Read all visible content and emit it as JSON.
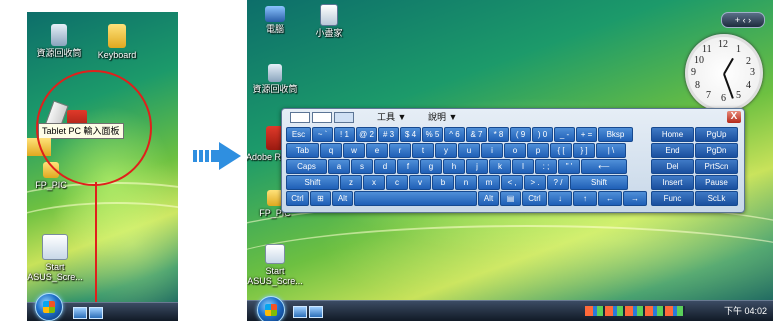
{
  "left_panel": {
    "icons": [
      {
        "name": "recycle-bin",
        "label": "資源回收筒"
      },
      {
        "name": "keyboard-folder",
        "label": "Keyboard"
      },
      {
        "name": "fp-pic",
        "label": "FP_PIC"
      },
      {
        "name": "start-asus",
        "label": "Start ASUS_Scre..."
      }
    ],
    "tooltip": "Tablet PC 輸入面板"
  },
  "right_panel": {
    "icons": [
      {
        "name": "computer",
        "label": "電腦"
      },
      {
        "name": "mini-utility",
        "label": "小盡家"
      },
      {
        "name": "recycle-bin",
        "label": "資源回收筒"
      },
      {
        "name": "adobe-reader",
        "label": "Adobe Reader"
      },
      {
        "name": "fp-pic",
        "label": "FP_PIC"
      },
      {
        "name": "start-asus",
        "label": "Start ASUS_Scre..."
      }
    ],
    "sidebar_controls": "+  ‹  ›",
    "clock_numbers": [
      "12",
      "1",
      "2",
      "3",
      "4",
      "5",
      "6",
      "7",
      "8",
      "9",
      "10",
      "11"
    ],
    "taskbar_time": "下午 04:02"
  },
  "keyboard": {
    "menu_tools": "工具 ▼",
    "menu_help": "說明 ▼",
    "close": "X",
    "rows": [
      [
        "Esc",
        "~ `",
        "! 1",
        "@ 2",
        "# 3",
        "$ 4",
        "% 5",
        "^ 6",
        "& 7",
        "* 8",
        "( 9",
        ") 0",
        "_ -",
        "+ =",
        "Bksp"
      ],
      [
        "Tab",
        "q",
        "w",
        "e",
        "r",
        "t",
        "y",
        "u",
        "i",
        "o",
        "p",
        "{ [",
        "} ]",
        "| \\"
      ],
      [
        "Caps",
        "a",
        "s",
        "d",
        "f",
        "g",
        "h",
        "j",
        "k",
        "l",
        ": ;",
        "\" '",
        "⟵"
      ],
      [
        "Shift",
        "z",
        "x",
        "c",
        "v",
        "b",
        "n",
        "m",
        "< ,",
        "> .",
        "? /",
        "Shift"
      ],
      [
        "Ctrl",
        "⊞",
        "Alt",
        "",
        "Alt",
        "▤",
        "Ctrl",
        "↓",
        "↑",
        "←",
        "→"
      ]
    ],
    "nav": [
      [
        "Home",
        "PgUp"
      ],
      [
        "End",
        "PgDn"
      ],
      [
        "Del",
        "PrtScn"
      ],
      [
        "Insert",
        "Pause"
      ],
      [
        "Func",
        "ScLk"
      ]
    ]
  },
  "colors": {
    "annotation": "#e0201b",
    "arrow": "#2f8fe0",
    "key": "#2f72c6"
  }
}
